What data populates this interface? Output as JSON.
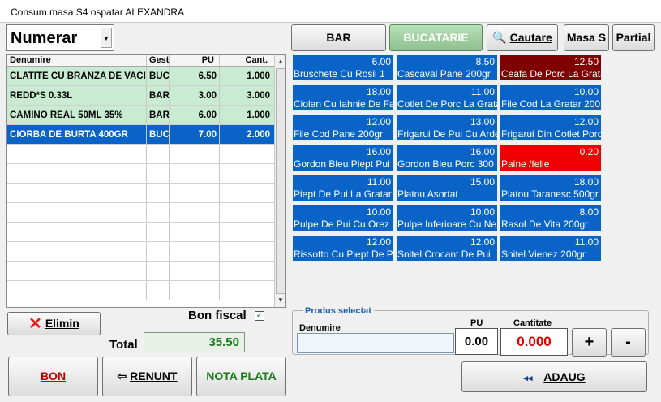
{
  "window": {
    "title": "Consum masa S4   ospatar ALEXANDRA"
  },
  "payment": {
    "selected": "Numerar"
  },
  "order": {
    "headers": [
      "Denumire",
      "Gest",
      "PU",
      "Cant."
    ],
    "rows": [
      {
        "name": "CLATITE CU BRANZA DE VACI",
        "gest": "BUCATARIE",
        "pu": "6.50",
        "cant": "1.000"
      },
      {
        "name": "REDD*S 0.33L",
        "gest": "BAR",
        "pu": "3.00",
        "cant": "3.000"
      },
      {
        "name": "CAMINO REAL 50ML 35%",
        "gest": "BAR",
        "pu": "6.00",
        "cant": "1.000"
      },
      {
        "name": "CIORBA DE BURTA 400GR",
        "gest": "BUCATARIE",
        "pu": "7.00",
        "cant": "2.000"
      }
    ]
  },
  "actions": {
    "elimin": "Elimin",
    "bon_fiscal_label": "Bon fiscal",
    "total_label": "Total",
    "total_value": "35.50",
    "bon": "BON",
    "renunt": "RENUNT",
    "nota_plata": "NOTA PLATA"
  },
  "tabs": {
    "bar": "BAR",
    "bucatarie": "BUCATARIE",
    "cautare": "Cautare",
    "masa": "Masa S",
    "partial": "Partial"
  },
  "products": [
    {
      "price": "6.00",
      "name": "Bruschete Cu Rosii 1"
    },
    {
      "price": "8.50",
      "name": "Cascaval Pane 200gr"
    },
    {
      "price": "12.50",
      "name": "Ceafa De Porc La Gratar"
    },
    {
      "price": "18.00",
      "name": "Ciolan Cu Iahnie De Fasole"
    },
    {
      "price": "11.00",
      "name": "Cotlet De Porc La Gratar"
    },
    {
      "price": "10.00",
      "name": "File Cod La Gratar 200"
    },
    {
      "price": "12.00",
      "name": "File Cod Pane 200gr"
    },
    {
      "price": "13.00",
      "name": "Frigarui De Pui Cu Ardei"
    },
    {
      "price": "12.00",
      "name": "Frigarui Din Cotlet Porc"
    },
    {
      "price": "16.00",
      "name": "Gordon Bleu Piept Pui"
    },
    {
      "price": "16.00",
      "name": "Gordon Bleu Porc 300"
    },
    {
      "price": "0.20",
      "name": "Paine /felie"
    },
    {
      "price": "11.00",
      "name": "Piept De Pui La Gratar"
    },
    {
      "price": "15.00",
      "name": "Platou Asortat"
    },
    {
      "price": "18.00",
      "name": "Platou Taranesc 500gr"
    },
    {
      "price": "10.00",
      "name": "Pulpe De Pui Cu Orez"
    },
    {
      "price": "10.00",
      "name": "Pulpe Inferioare Cu Ne"
    },
    {
      "price": "8.00",
      "name": "Rasol De Vita 200gr"
    },
    {
      "price": "12.00",
      "name": "Rissotto Cu Piept De Pui"
    },
    {
      "price": "12.00",
      "name": "Snitel Crocant De Pui"
    },
    {
      "price": "11.00",
      "name": "Snitel Vienez 200gr"
    }
  ],
  "selected_product": {
    "legend": "Produs selectat",
    "denumire_label": "Denumire",
    "denumire_value": "",
    "pu_label": "PU",
    "pu_value": "0.00",
    "cant_label": "Cantitate",
    "cant_value": "0.000",
    "plus": "+",
    "minus": "-",
    "adaug": "ADAUG"
  },
  "colors": {
    "selected_row": "#0a64c8",
    "green_row": "#c8ebd2",
    "product_tile": "#0a64c8",
    "dark_tile": "#800000",
    "red_tile": "#f00000"
  }
}
